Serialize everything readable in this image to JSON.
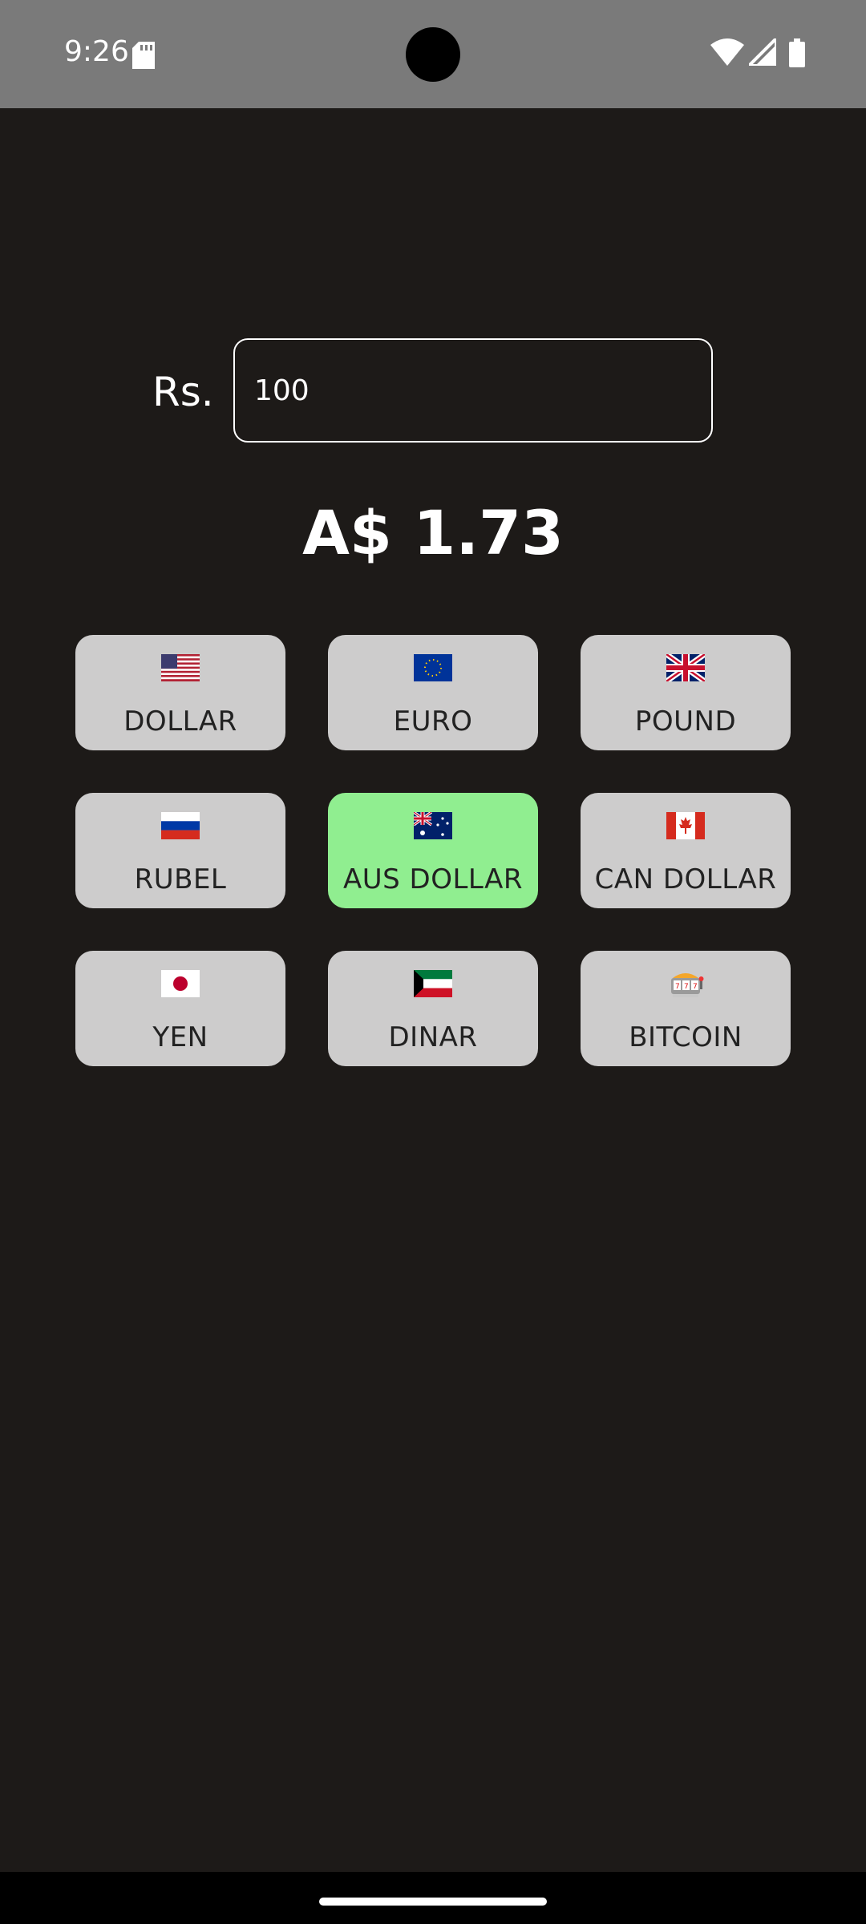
{
  "status_bar": {
    "time": "9:26",
    "icons": [
      "sd-card-icon",
      "wifi-icon",
      "cell-signal-icon",
      "battery-icon"
    ]
  },
  "converter": {
    "currency_prefix": "Rs.",
    "amount_value": "100",
    "result": "A$ 1.73"
  },
  "buttons": [
    {
      "label": "DOLLAR",
      "icon": "us-flag-icon"
    },
    {
      "label": "EURO",
      "icon": "eu-flag-icon"
    },
    {
      "label": "POUND",
      "icon": "uk-flag-icon"
    },
    {
      "label": "RUBEL",
      "icon": "russia-flag-icon"
    },
    {
      "label": "AUS DOLLAR",
      "icon": "australia-flag-icon",
      "selected": true
    },
    {
      "label": "CAN DOLLAR",
      "icon": "canada-flag-icon"
    },
    {
      "label": "YEN",
      "icon": "japan-flag-icon"
    },
    {
      "label": "DINAR",
      "icon": "kuwait-flag-icon"
    },
    {
      "label": "BITCOIN",
      "icon": "slot-machine-icon"
    }
  ],
  "colors": {
    "background": "#1d1a18",
    "button": "#cdcccc",
    "button_selected": "#90ee90",
    "status_bar": "#7a7a7a"
  }
}
